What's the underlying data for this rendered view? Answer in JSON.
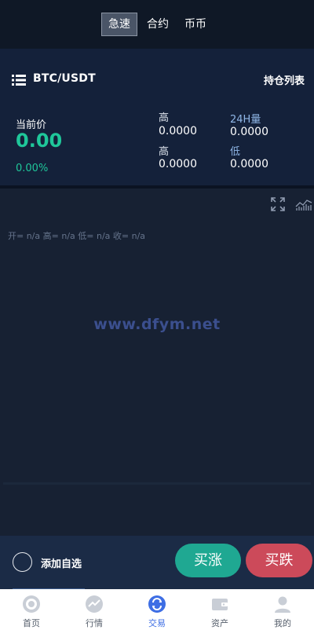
{
  "header": {
    "tabs": [
      {
        "label": "急速",
        "active": true
      },
      {
        "label": "合约",
        "active": false
      },
      {
        "label": "币币",
        "active": false
      }
    ]
  },
  "ticker": {
    "pair": "BTC/USDT",
    "holdings_label": "持仓列表",
    "current_price_label": "当前价",
    "current_price": "0.00",
    "change_pct": "0.00%",
    "stats": {
      "high_label_1": "高",
      "high_value_1": "0.0000",
      "volume_label": "24H量",
      "volume_value": "0.0000",
      "high_label_2": "高",
      "high_value_2": "0.0000",
      "low_label": "低",
      "low_value": "0.0000"
    }
  },
  "chart": {
    "ohlc_text": "开= n/a  高= n/a  低= n/a  收= n/a",
    "watermark": "www.dfym.net",
    "fullscreen_icon": "expand-icon",
    "indicator_icon": "indicator-chart-icon"
  },
  "actions": {
    "favorite_label": "添加自选",
    "buy_label": "买涨",
    "sell_label": "买跌"
  },
  "nav": {
    "items": [
      {
        "label": "首页",
        "icon": "home-icon",
        "active": false
      },
      {
        "label": "行情",
        "icon": "market-icon",
        "active": false
      },
      {
        "label": "交易",
        "icon": "trade-icon",
        "active": true
      },
      {
        "label": "资产",
        "icon": "wallet-icon",
        "active": false
      },
      {
        "label": "我的",
        "icon": "user-icon",
        "active": false
      }
    ]
  },
  "colors": {
    "up": "#1fc79a",
    "buy_button": "#1fa892",
    "sell_button": "#cc4a5a",
    "nav_active": "#3e6ee4",
    "background": "#162033"
  }
}
